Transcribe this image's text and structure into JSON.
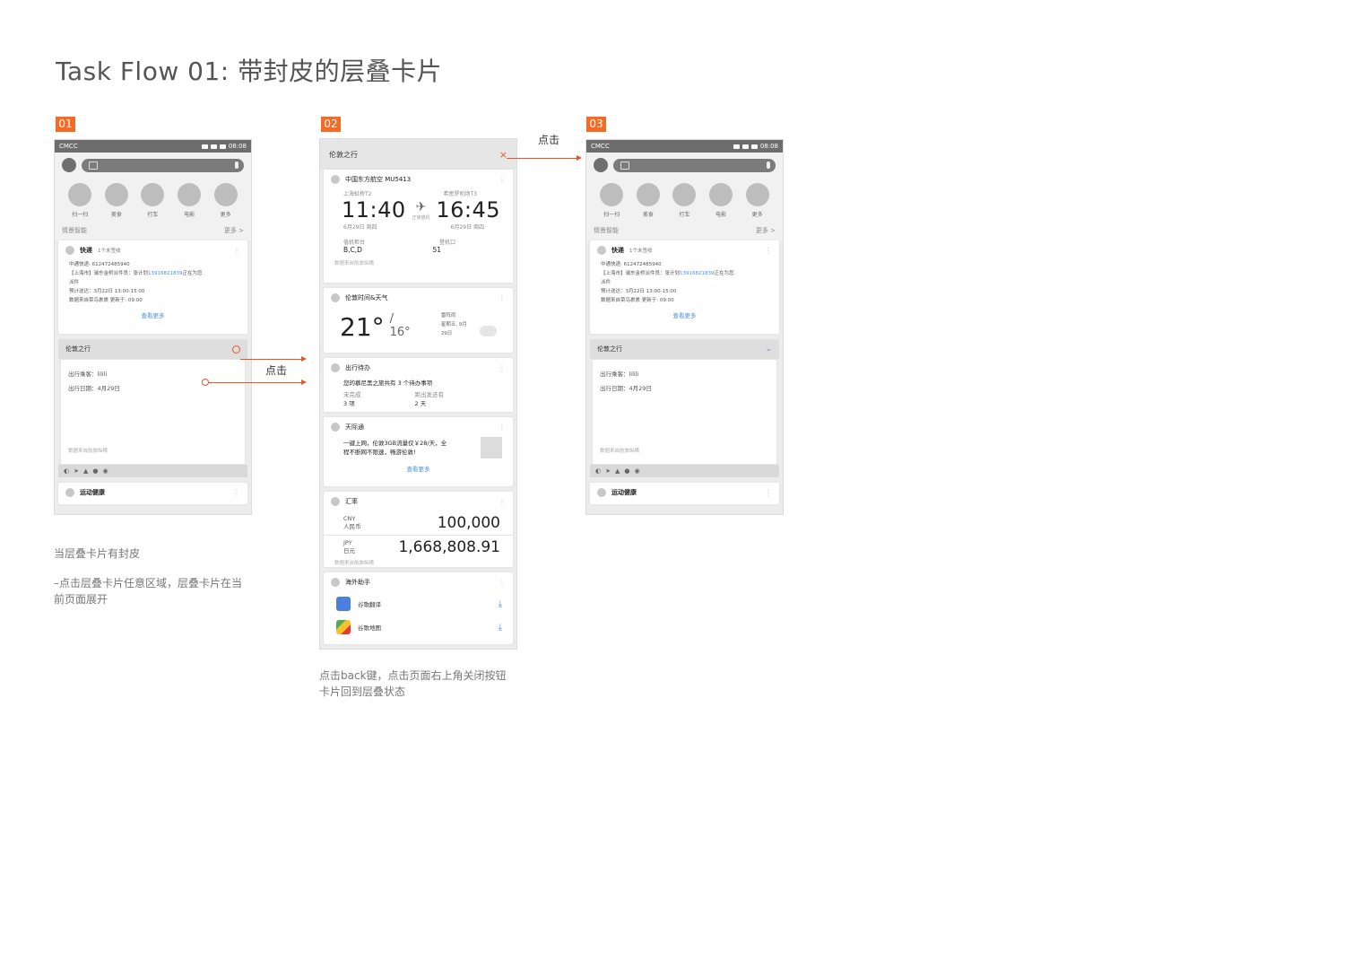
{
  "page": {
    "title": "Task Flow 01: 带封皮的层叠卡片"
  },
  "steps": [
    "01",
    "02",
    "03"
  ],
  "annotations": {
    "tap_label_1": "点击",
    "tap_label_2": "点击"
  },
  "captions": {
    "step1_title": "当层叠卡片有封皮",
    "step1_desc": "–点击层叠卡片任意区域，层叠卡片在当前页面展开",
    "step2_desc_1": "点击back键，点击页面右上角关闭按钮",
    "step2_desc_2": "卡片回到层叠状态"
  },
  "home_screen": {
    "carrier": "CMCC",
    "time": "08:08",
    "shortcuts": [
      "扫一扫",
      "美食",
      "打车",
      "电影",
      "更多"
    ],
    "section_title": "情景智能",
    "section_more": "更多 >",
    "express_card": {
      "title": "快递",
      "subtitle": "1个未签收",
      "line1": "中通快递: 612472485940",
      "line2_prefix": "【上海市】浦东金桥派件员：张计划",
      "line2_phone": "13916821839",
      "line2_suffix": "正在为您",
      "line3": "派件",
      "line4": "预计送达：3月22日  13:00-15:00",
      "line5": "数据来自菜鸟裹裹   更新于: 09:00",
      "more": "查看更多"
    },
    "stack_card": {
      "cover_title": "伦敦之行",
      "passenger": "出行乘客：lilili",
      "date": "出行日期：4月29日",
      "source": "数据来自航旅纵横"
    },
    "health_card": {
      "title": "运动健康"
    }
  },
  "expanded": {
    "header_title": "伦敦之行",
    "close_icon": "×",
    "flight": {
      "airline": "中国东方航空 MU5413",
      "dep_airport": "上海虹桥T2",
      "arr_airport": "希思罗机场T3",
      "dep_time": "11:40",
      "arr_time": "16:45",
      "status": "正常值机",
      "dep_date": "6月29日 周四",
      "arr_date": "6月29日 周四",
      "counter_label": "值机柜台",
      "counter_value": "B,C,D",
      "gate_label": "登机口",
      "gate_value": "51",
      "source": "数据来自航旅纵横"
    },
    "weather": {
      "title": "伦敦时间&天气",
      "temp_high": "21°",
      "temp_low": "/ 16°",
      "condition": "雷阵雨",
      "date": "星期五, 9月 29日"
    },
    "todo": {
      "title": "出行待办",
      "summary": "您的慕尼黑之旅共有 3 个待办事项",
      "left_label": "未完成",
      "left_value": "3 项",
      "right_label": "距出发还有",
      "right_value": "2 天"
    },
    "skyroam": {
      "title": "天际通",
      "text_1": "一键上网，伦敦3GB流量仅￥28/天，全",
      "text_2": "程不断网不限速，畅游伦敦!",
      "more": "查看更多"
    },
    "exchange": {
      "title": "汇率",
      "cny_code": "CNY",
      "cny_name": "人民币",
      "cny_value": "100,000",
      "jpy_code": "JPY",
      "jpy_name": "日元",
      "jpy_value": "1,668,808.91",
      "source": "数据来自航旅纵横"
    },
    "assistant": {
      "title": "海外助手",
      "app1": "谷歌翻译",
      "app2": "谷歌地图"
    }
  },
  "colors": {
    "accent": "#f36b24",
    "arrow": "#e4572e",
    "link": "#4a8fe0"
  }
}
